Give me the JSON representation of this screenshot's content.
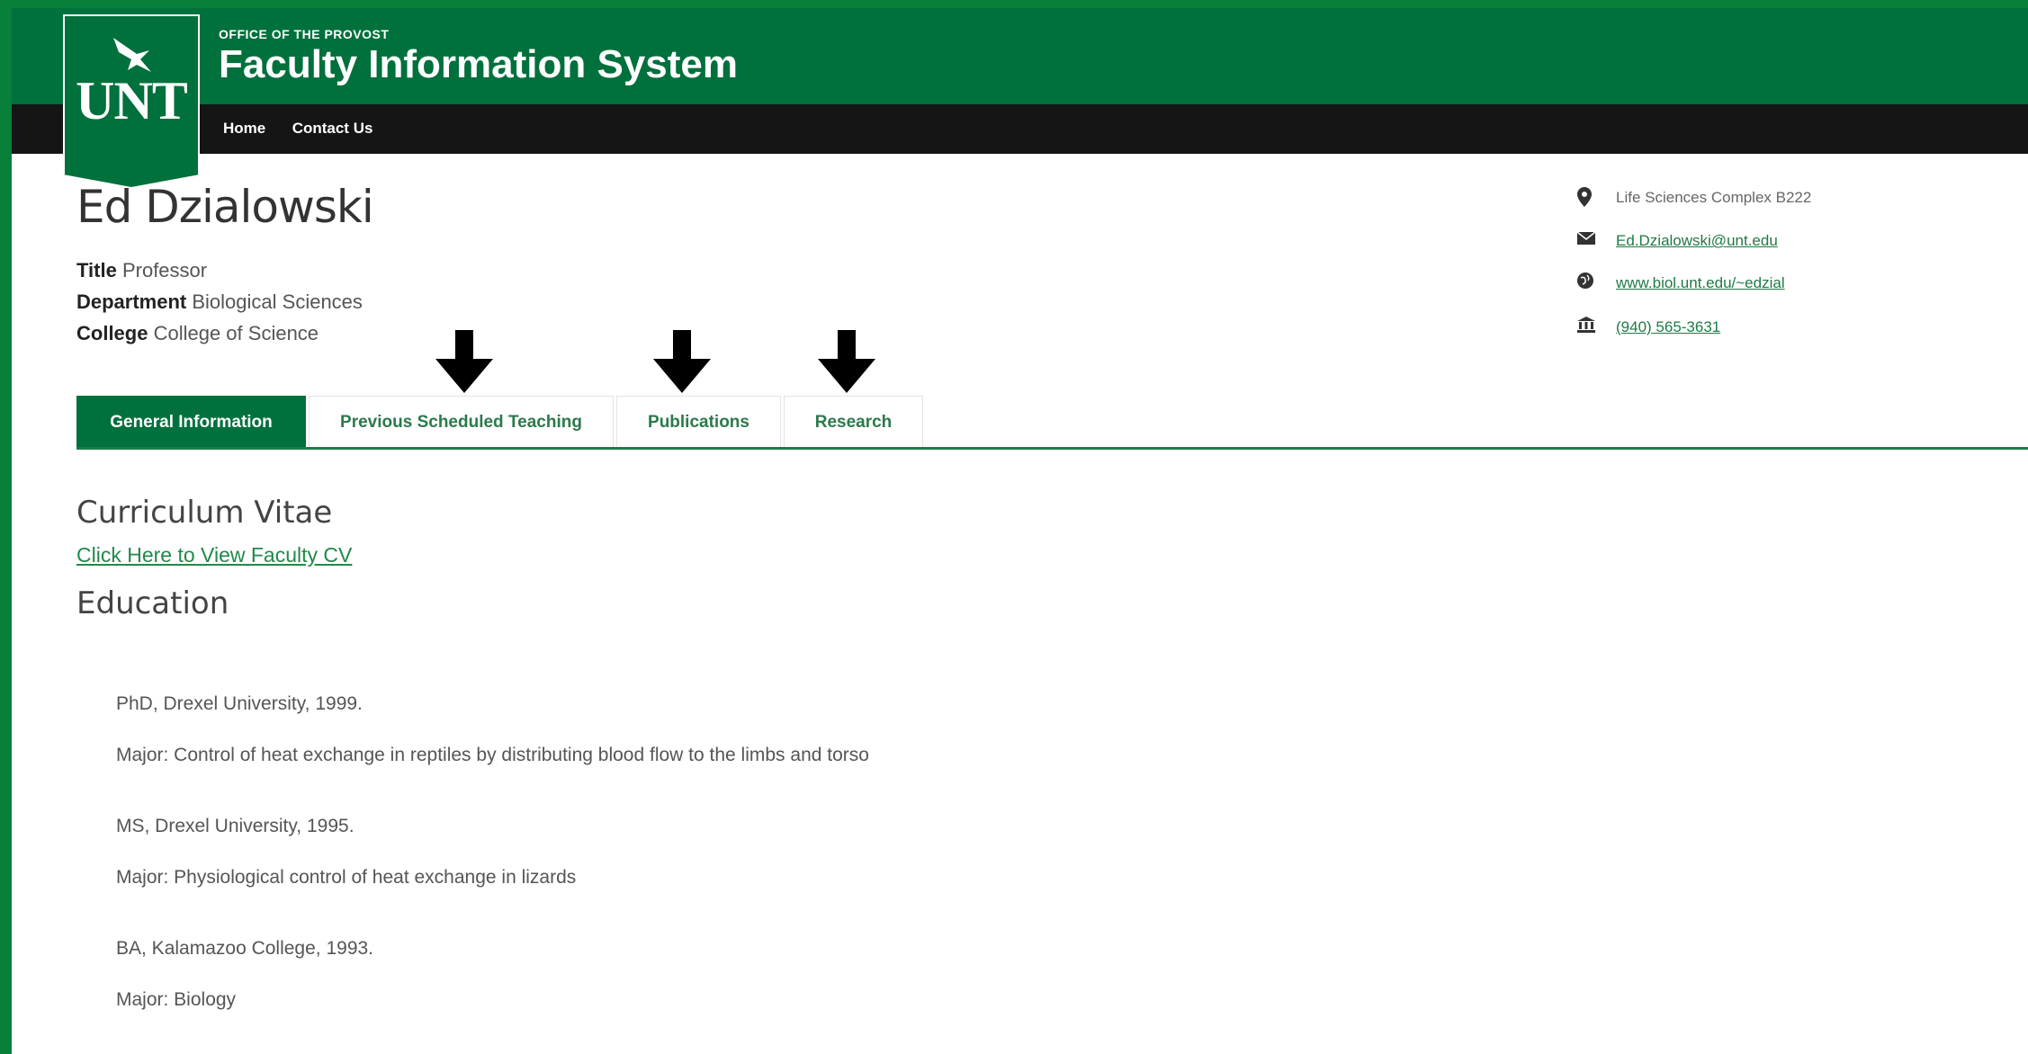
{
  "header": {
    "logo_text": "UNT",
    "office_label": "OFFICE OF THE PROVOST",
    "title": "Faculty Information System"
  },
  "nav": {
    "items": [
      "Home",
      "Contact Us"
    ]
  },
  "profile": {
    "name": "Ed Dzialowski",
    "fields": [
      {
        "label": "Title",
        "value": "Professor"
      },
      {
        "label": "Department",
        "value": "Biological Sciences"
      },
      {
        "label": "College",
        "value": "College of Science"
      }
    ]
  },
  "contact": {
    "location": "Life Sciences Complex B222",
    "email": "Ed.Dzialowski@unt.edu",
    "website": "www.biol.unt.edu/~edzial",
    "phone": "(940) 565-3631",
    "icons": [
      "map-marker-icon",
      "envelope-icon",
      "globe-icon",
      "building-icon"
    ]
  },
  "tabs": [
    {
      "label": "General Information",
      "active": true
    },
    {
      "label": "Previous Scheduled Teaching",
      "active": false
    },
    {
      "label": "Publications",
      "active": false
    },
    {
      "label": "Research",
      "active": false
    }
  ],
  "main": {
    "cv_heading": "Curriculum Vitae",
    "cv_link": "Click Here to View Faculty CV",
    "education_heading": "Education",
    "education": [
      {
        "degree": "PhD, Drexel University, 1999.",
        "major": "Major: Control of heat exchange in reptiles by distributing blood flow to the limbs and torso"
      },
      {
        "degree": "MS, Drexel University, 1995.",
        "major": "Major: Physiological control of heat exchange in lizards"
      },
      {
        "degree": "BA, Kalamazoo College, 1993.",
        "major": "Major: Biology"
      }
    ]
  },
  "colors": {
    "primary_green": "#00703c",
    "nav_black": "#151515",
    "frame_green": "#08803a",
    "link_green": "#1f8a4a"
  }
}
